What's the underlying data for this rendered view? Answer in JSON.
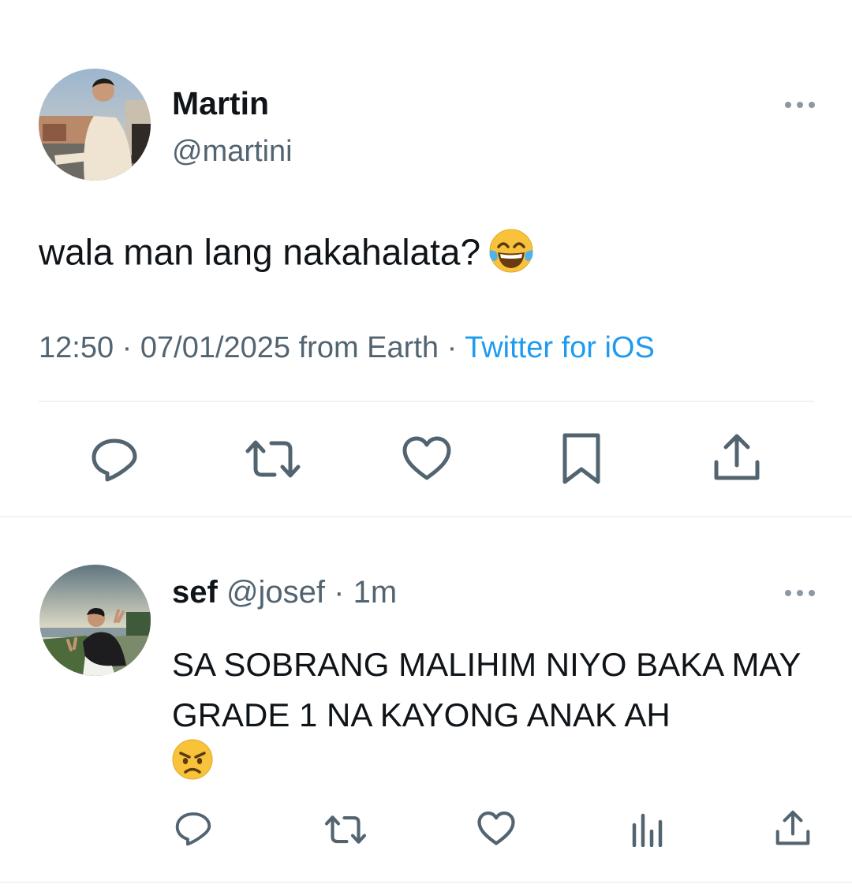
{
  "main_tweet": {
    "author_name": "Martin",
    "author_handle": "@martini",
    "text": "wala man lang nakahalata?",
    "text_emoji": "face-with-tears-of-joy",
    "time": "12:50",
    "date": "07/01/2025",
    "location": "from Earth",
    "source": "Twitter for iOS",
    "separator": "·",
    "actions": [
      "reply-icon",
      "retweet-icon",
      "like-icon",
      "bookmark-icon",
      "share-icon"
    ]
  },
  "reply": {
    "author_name": "sef",
    "author_handle": "@josef",
    "separator": "·",
    "time_ago": "1m",
    "text": "SA SOBRANG MALIHIM NIYO BAKA MAY GRADE 1 NA KAYONG ANAK AH",
    "text_emoji": "angry-face",
    "actions": [
      "reply-icon",
      "retweet-icon",
      "like-icon",
      "views-icon",
      "share-icon"
    ]
  },
  "colors": {
    "text_primary": "#0f1419",
    "text_secondary": "#536471",
    "link": "#1d9bf0",
    "icon": "#536471",
    "divider": "#eff3f4"
  }
}
